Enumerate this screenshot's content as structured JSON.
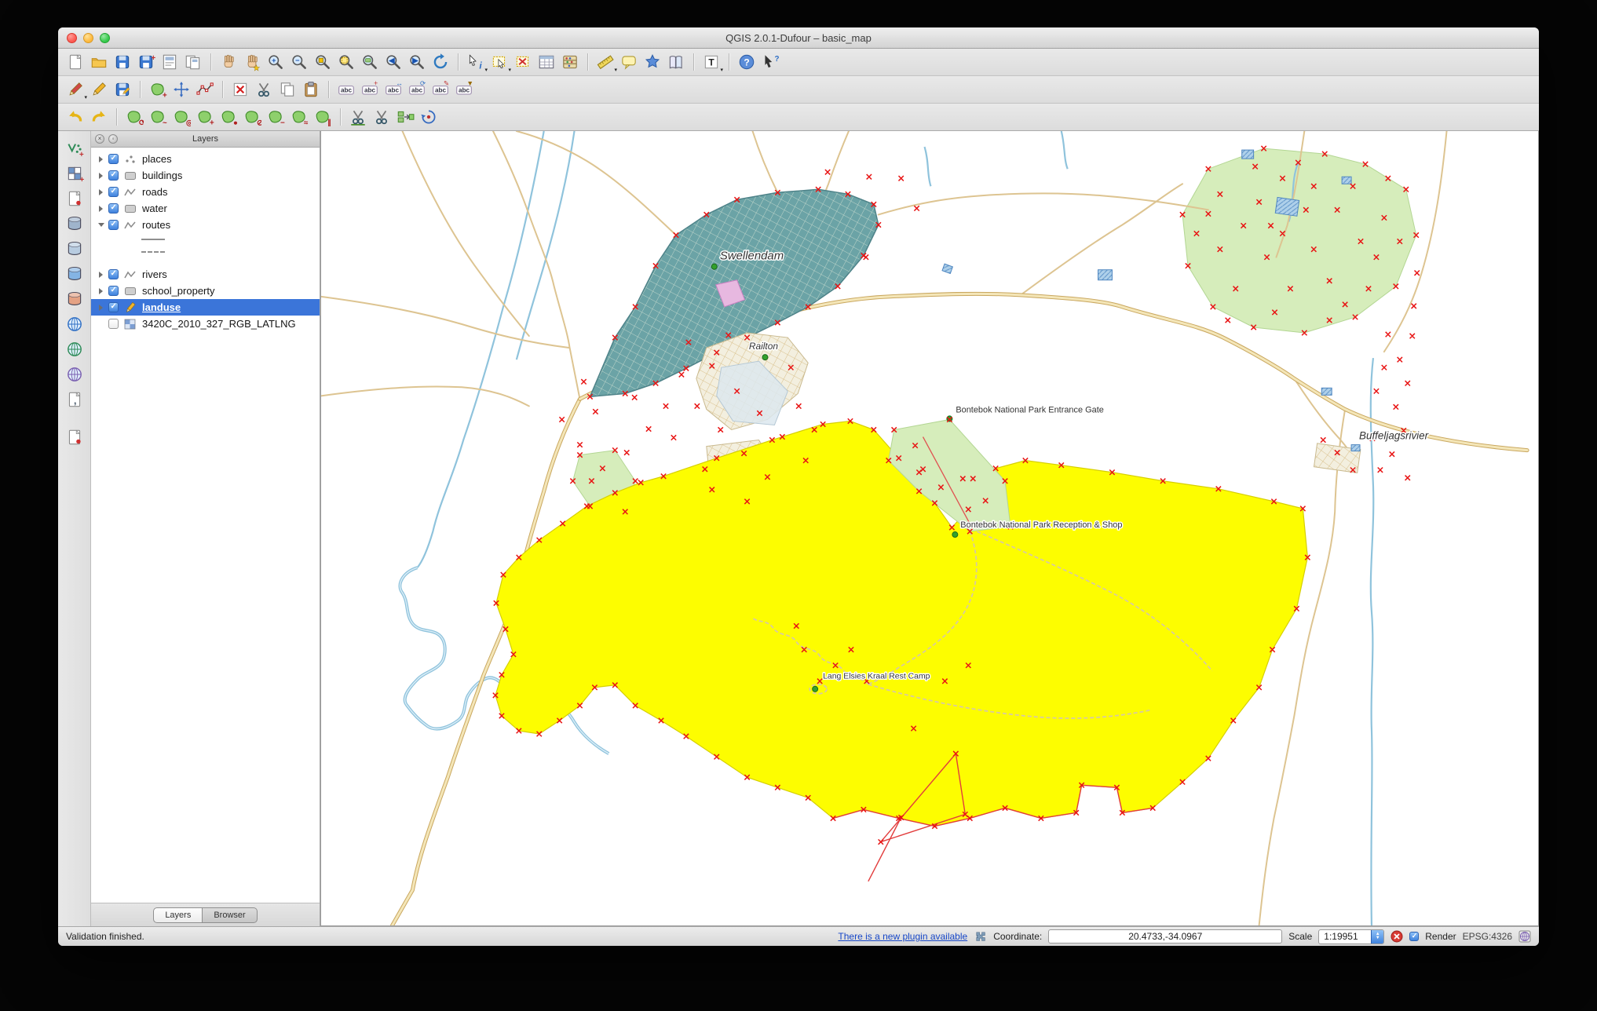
{
  "window_title": "QGIS 2.0.1-Dufour – basic_map",
  "colors": {
    "selection_blue": "#3b75d9",
    "landuse_yellow": "#fdfd00",
    "vertex_marker_red": "#e81414",
    "town_teal": "#6ba3a6",
    "park_green": "#d6edbb",
    "water_blue": "#8fc3dc",
    "link_blue": "#1747c8"
  },
  "toolbars": {
    "row1": [
      {
        "n": "new-project",
        "t": "page"
      },
      {
        "n": "open-project",
        "t": "folder"
      },
      {
        "n": "save-project",
        "t": "floppy"
      },
      {
        "n": "save-project-as",
        "t": "floppy-plus"
      },
      {
        "n": "new-print-composer",
        "t": "composer"
      },
      {
        "n": "composer-manager",
        "t": "composer2"
      },
      {
        "sep": true
      },
      {
        "n": "pan-map",
        "t": "hand"
      },
      {
        "n": "pan-to-selection",
        "t": "hand-star"
      },
      {
        "n": "zoom-in",
        "t": "mag",
        "ov": "+"
      },
      {
        "n": "zoom-out",
        "t": "mag",
        "ov": "−"
      },
      {
        "n": "zoom-full",
        "t": "mag-full"
      },
      {
        "n": "zoom-to-selection",
        "t": "mag-sel"
      },
      {
        "n": "zoom-to-layer",
        "t": "mag-layer"
      },
      {
        "n": "zoom-last",
        "t": "mag",
        "ov": "◀"
      },
      {
        "n": "zoom-next",
        "t": "mag",
        "ov": "▶"
      },
      {
        "n": "refresh-map",
        "t": "refresh"
      },
      {
        "sep": true
      },
      {
        "n": "identify-features",
        "t": "identify",
        "dd": true
      },
      {
        "n": "select-features",
        "t": "selectrect",
        "dd": true
      },
      {
        "n": "deselect-all",
        "t": "deselect"
      },
      {
        "n": "open-attribute-table",
        "t": "table"
      },
      {
        "n": "field-calculator",
        "t": "calc"
      },
      {
        "sep": true
      },
      {
        "n": "measure-line",
        "t": "ruler",
        "dd": true
      },
      {
        "n": "map-tips",
        "t": "balloon"
      },
      {
        "n": "new-bookmark",
        "t": "star"
      },
      {
        "n": "show-bookmarks",
        "t": "book"
      },
      {
        "sep": true
      },
      {
        "n": "text-annotation",
        "t": "textT",
        "dd": true
      },
      {
        "sep": true
      },
      {
        "n": "help-contents",
        "t": "question"
      },
      {
        "n": "whats-this",
        "t": "arrowq"
      }
    ],
    "row2": [
      {
        "n": "current-edits",
        "t": "brush",
        "dd": true
      },
      {
        "n": "toggle-editing",
        "t": "pencil"
      },
      {
        "n": "save-layer-edits",
        "t": "floppy-edit"
      },
      {
        "sep": true
      },
      {
        "n": "add-feature",
        "t": "greenblob",
        "ov": "+"
      },
      {
        "n": "move-feature",
        "t": "movefeat"
      },
      {
        "n": "node-tool",
        "t": "node"
      },
      {
        "sep": true
      },
      {
        "n": "delete-selected",
        "t": "deletesel"
      },
      {
        "n": "cut-features",
        "t": "scissors"
      },
      {
        "n": "copy-features",
        "t": "copy"
      },
      {
        "n": "paste-features",
        "t": "paste"
      },
      {
        "sep": true
      },
      {
        "n": "labeling-options",
        "t": "abc"
      },
      {
        "n": "label-add",
        "t": "abc",
        "mk": "+",
        "mc": "#c03030"
      },
      {
        "n": "label-move",
        "t": "abc",
        "mk": "↔",
        "mc": "#2f6fc4"
      },
      {
        "n": "label-rotate",
        "t": "abc",
        "mk": "⟳",
        "mc": "#2f6fc4"
      },
      {
        "n": "label-change",
        "t": "abc",
        "mk": "✎",
        "mc": "#c03030"
      },
      {
        "n": "label-pin",
        "t": "abc",
        "mk": "▼",
        "mc": "#996a00"
      }
    ],
    "row3": [
      {
        "n": "undo",
        "t": "undo"
      },
      {
        "n": "redo",
        "t": "redo"
      },
      {
        "sep": true
      },
      {
        "n": "rotate-feature",
        "t": "greenblob",
        "ov": "⟳"
      },
      {
        "n": "simplify-feature",
        "t": "greenblob",
        "ov": "~"
      },
      {
        "n": "add-ring",
        "t": "greenblob",
        "ov": "◎"
      },
      {
        "n": "add-part",
        "t": "greenblob",
        "ov": "+"
      },
      {
        "n": "fill-ring",
        "t": "greenblob",
        "ov": "●"
      },
      {
        "n": "delete-ring",
        "t": "greenblob",
        "ov": "⊘"
      },
      {
        "n": "delete-part",
        "t": "greenblob",
        "ov": "−"
      },
      {
        "n": "reshape-features",
        "t": "greenblob",
        "ov": "≈"
      },
      {
        "n": "offset-curve",
        "t": "greenblob",
        "ov": "∥"
      },
      {
        "sep": true
      },
      {
        "n": "split-features",
        "t": "scissors2"
      },
      {
        "n": "split-parts",
        "t": "scissors"
      },
      {
        "n": "merge-features",
        "t": "merge"
      },
      {
        "n": "rotate-point-symbols",
        "t": "rotsym"
      }
    ],
    "side": [
      {
        "n": "add-vector-layer",
        "t": "vlayer",
        "c": "#2e8b57"
      },
      {
        "n": "add-raster-layer",
        "t": "rasterlayer"
      },
      {
        "n": "new-shapefile-layer",
        "t": "newshp"
      },
      {
        "n": "add-postgis-layer",
        "t": "dbcyl",
        "c": "#9fb4cc"
      },
      {
        "n": "add-spatialite-layer",
        "t": "dbcyl",
        "c": "#b8cce0"
      },
      {
        "n": "add-mssql-layer",
        "t": "dbcyl",
        "c": "#84b4e4"
      },
      {
        "n": "add-oracle-layer",
        "t": "dbcyl",
        "c": "#e4a284"
      },
      {
        "n": "add-wms-layer",
        "t": "globe",
        "c": "#2f6fc4"
      },
      {
        "n": "add-wcs-layer",
        "t": "globe",
        "c": "#2e8b57"
      },
      {
        "n": "add-wfs-layer",
        "t": "globe",
        "c": "#7a5fb0"
      },
      {
        "n": "add-delimited-text-layer",
        "t": "page-comma"
      },
      {
        "gap": true
      },
      {
        "n": "new-memory-layer",
        "t": "newshp"
      }
    ]
  },
  "layers_panel": {
    "title": "Layers",
    "items": [
      {
        "label": "places",
        "checked": true,
        "icon": "point",
        "arrow": "right"
      },
      {
        "label": "buildings",
        "checked": true,
        "icon": "polygon",
        "arrow": "right"
      },
      {
        "label": "roads",
        "checked": true,
        "icon": "line",
        "arrow": "right"
      },
      {
        "label": "water",
        "checked": true,
        "icon": "polygon",
        "arrow": "right"
      },
      {
        "label": "routes",
        "checked": true,
        "icon": "line",
        "arrow": "down"
      },
      {
        "symbol": "solid"
      },
      {
        "symbol": "dashed"
      },
      {
        "label": "rivers",
        "checked": true,
        "icon": "line",
        "arrow": "right",
        "gap": true
      },
      {
        "label": "school_property",
        "checked": true,
        "icon": "polygon",
        "arrow": "right"
      },
      {
        "label": "landuse",
        "checked": true,
        "icon": "pencil",
        "arrow": "right",
        "selected": true
      },
      {
        "label": "3420C_2010_327_RGB_LATLNG",
        "checked": false,
        "icon": "raster",
        "arrow": null
      }
    ],
    "tabs": [
      {
        "label": "Layers",
        "active": true
      },
      {
        "label": "Browser",
        "active": false
      }
    ]
  },
  "map": {
    "labels": [
      {
        "id": "swellendam",
        "text": "Swellendam"
      },
      {
        "id": "railton",
        "text": "Railton"
      },
      {
        "id": "entrance-gate",
        "text": "Bontebok National Park Entrance Gate"
      },
      {
        "id": "reception-shop",
        "text": "Bontebok National Park Reception & Shop"
      },
      {
        "id": "rest-camp",
        "text": "Lang Elsies Kraal Rest Camp"
      },
      {
        "id": "buffeljagsrivier",
        "text": "Buffeljagsrivier"
      }
    ]
  },
  "statusbar": {
    "message": "Validation finished.",
    "plugin_link": "There is a new plugin available",
    "coordinate_label": "Coordinate:",
    "coordinate_value": "20.4733,-34.0967",
    "scale_label": "Scale",
    "scale_value": "1:19951",
    "render_label": "Render",
    "crs_label": "EPSG:4326"
  }
}
